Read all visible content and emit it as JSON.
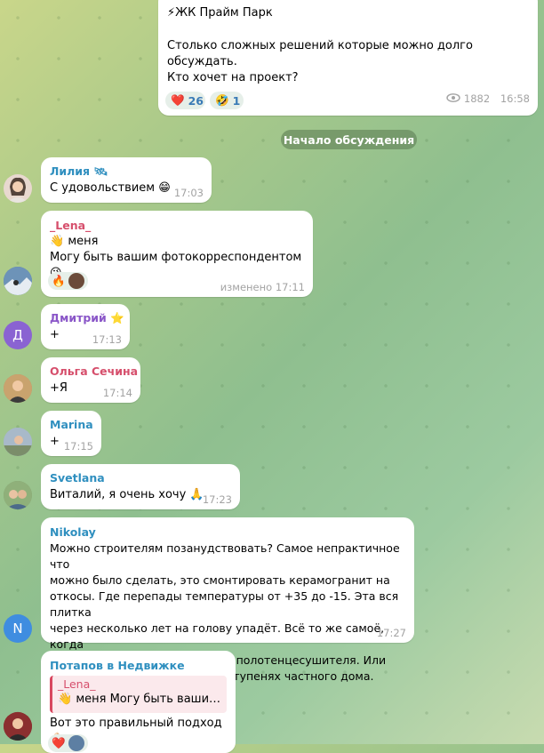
{
  "post": {
    "title": "⚡ЖК Прайм Парк",
    "line1": "Столько сложных решений которые можно долго обсуждать.",
    "line2": "Кто хочет на проект?",
    "reaction_heart": "❤️",
    "reaction_heart_count": "26",
    "reaction_laugh": "🤣",
    "reaction_laugh_count": "1",
    "views": "1882",
    "time": "16:58"
  },
  "discussion_start": "Начало обсуждения",
  "messages": [
    {
      "author": "Лилия 🛰",
      "author_color": "#2f8fbf",
      "text": "С удовольствием 😁",
      "time": "17:03"
    },
    {
      "author": "_Lena_",
      "author_color": "#d64f6c",
      "text": "👋 меня\nМогу быть вашим фотокорреспондентом 😉",
      "time": "изменено 17:11",
      "reaction": "🔥"
    },
    {
      "author": "Дмитрий ⭐",
      "author_color": "#8a56c8",
      "avatar_letter": "Д",
      "text": "+",
      "time": "17:13"
    },
    {
      "author": "Ольга Сечина",
      "author_color": "#d64f6c",
      "text": "+Я",
      "time": "17:14"
    },
    {
      "author": "Marina",
      "author_color": "#2f8fbf",
      "text": "+",
      "time": "17:15"
    },
    {
      "author": "Svetlana",
      "author_color": "#2f8fbf",
      "text": "Виталий, я очень хочу 🙏",
      "time": "17:23"
    },
    {
      "author": "Nikolay",
      "author_color": "#2f8fbf",
      "avatar_letter": "N",
      "text": "Можно строителям позанудствовать? Самое непрактичное что\nможно было сделать, это смонтировать керамогранит на\nоткосы. Где перепады температуры от +35 до -15. Эта вся плитка\nчерез несколько лет на голову упадёт. Всё то же самоё, когда\nмонтируют теплый пол взамен полотенцесушителя. Или\nиспользуют керамогранит на ступенях частного дома.",
      "time": "17:27"
    },
    {
      "author": "Потапов в Недвижке",
      "author_color": "#2f8fbf",
      "quote_author": "_Lena_",
      "quote_text": "👋 меня  Могу быть ваши…",
      "text": "Вот это правильный подход 💪🏻",
      "reaction": "❤️"
    }
  ]
}
